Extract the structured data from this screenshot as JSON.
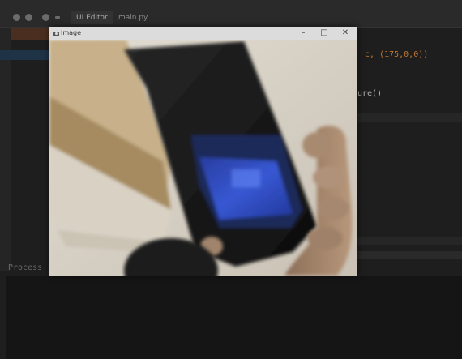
{
  "ide": {
    "tabs": [
      {
        "label": "UI Editor"
      },
      {
        "label": "main.py"
      }
    ],
    "code_lines": [
      {
        "text": "c, (175,0,0))"
      },
      {
        "text": "ure()"
      },
      {
        "text": "Process"
      }
    ]
  },
  "video_window": {
    "title": "Image",
    "minimize_glyph": "–",
    "maximize_glyph": "□",
    "close_glyph": "✕",
    "content": {
      "description_icon": "webcam-frame",
      "colors": {
        "wall": "#d8d2c8",
        "cabinet": "#b39a73",
        "phone": "#151515",
        "phone_screen": "#3050c8",
        "hand": "#a5856a",
        "head": "#181818"
      }
    }
  }
}
